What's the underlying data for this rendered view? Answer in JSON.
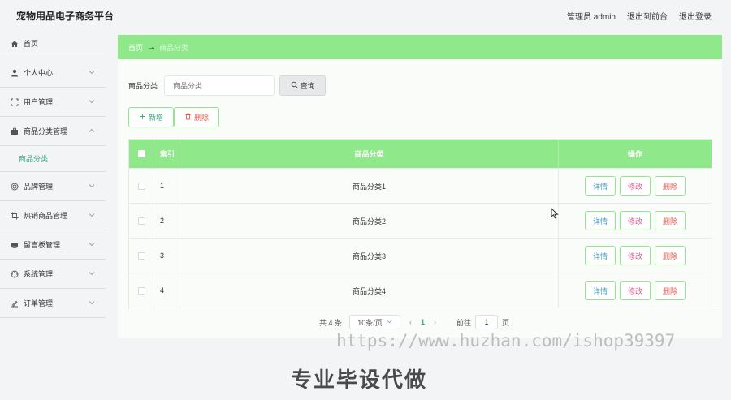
{
  "header": {
    "title": "宠物用品电子商务平台",
    "user": "管理员 admin",
    "front_link": "退出到前台",
    "logout": "退出登录"
  },
  "sidebar": {
    "items": [
      {
        "label": "首页",
        "icon": "home-icon"
      },
      {
        "label": "个人中心",
        "icon": "user-icon"
      },
      {
        "label": "用户管理",
        "icon": "frame-icon"
      },
      {
        "label": "商品分类管理",
        "icon": "briefcase-icon"
      },
      {
        "label": "品牌管理",
        "icon": "target-icon"
      },
      {
        "label": "热销商品管理",
        "icon": "crop-icon"
      },
      {
        "label": "留言板管理",
        "icon": "printer-icon"
      },
      {
        "label": "系统管理",
        "icon": "compass-icon"
      },
      {
        "label": "订单管理",
        "icon": "edit-icon"
      }
    ],
    "sub_item": "商品分类"
  },
  "breadcrumb": {
    "home": "首页",
    "separator": "→",
    "current": "商品分类"
  },
  "search": {
    "label": "商品分类",
    "placeholder": "商品分类",
    "button": "查询"
  },
  "actions": {
    "add": "新增",
    "delete": "删除"
  },
  "table": {
    "headers": {
      "index": "索引",
      "category": "商品分类",
      "ops": "操作"
    },
    "rows": [
      {
        "index": "1",
        "category": "商品分类1"
      },
      {
        "index": "2",
        "category": "商品分类2"
      },
      {
        "index": "3",
        "category": "商品分类3"
      },
      {
        "index": "4",
        "category": "商品分类4"
      }
    ],
    "op_labels": {
      "detail": "详情",
      "edit": "修改",
      "delete": "删除"
    }
  },
  "pagination": {
    "total": "共 4 条",
    "page_size": "10条/页",
    "current_page": "1",
    "goto_label": "前往",
    "goto_value": "1",
    "page_unit": "页"
  },
  "watermark": {
    "url": "https://www.huzhan.com/ishop39397",
    "text": "专业毕设代做"
  },
  "colors": {
    "accent": "#8fe98b",
    "link_green": "#3aa582",
    "danger": "#e05a4f"
  }
}
